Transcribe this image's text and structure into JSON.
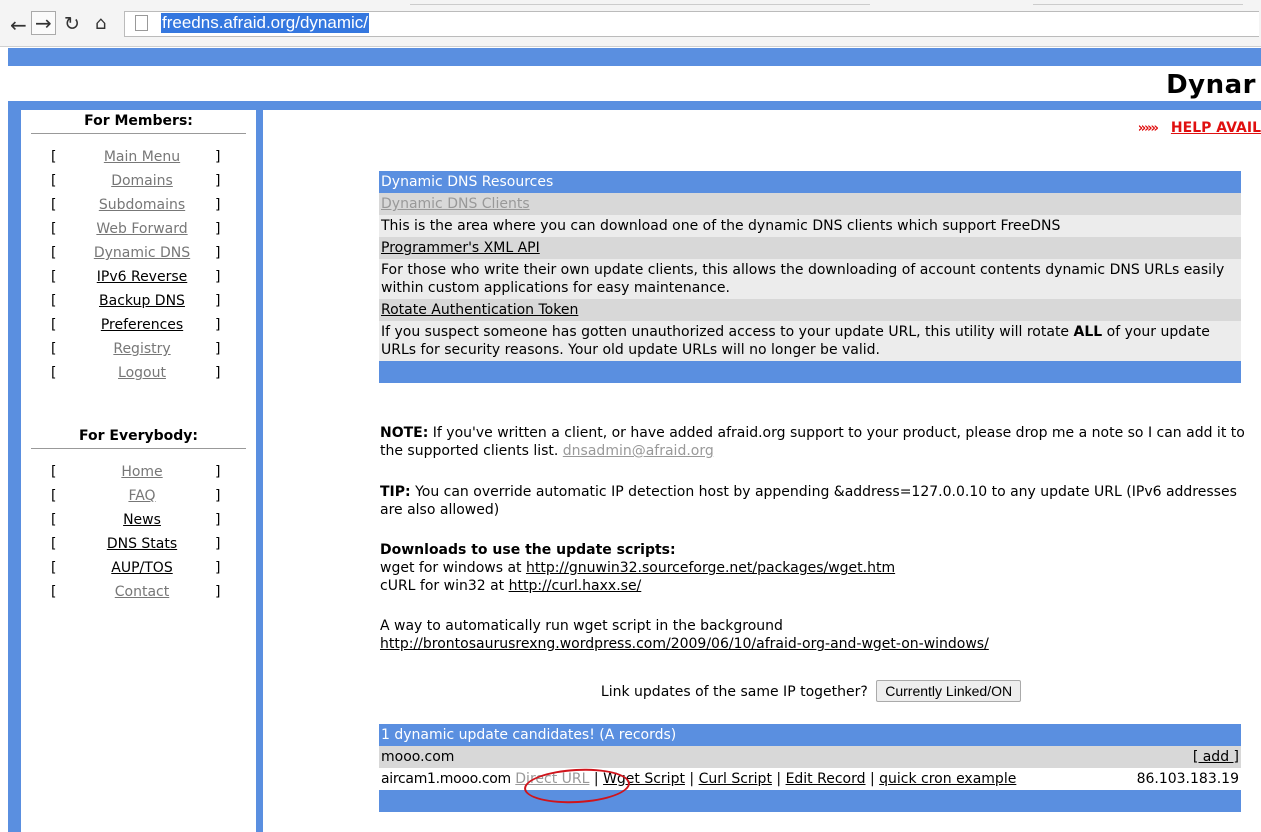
{
  "browser": {
    "url": "freedns.afraid.org/dynamic/"
  },
  "banner": {
    "title": "Dynar"
  },
  "sidebar": {
    "members_title": "For Members:",
    "members": [
      "Main Menu",
      "Domains",
      "Subdomains",
      "Web Forward",
      "Dynamic DNS",
      "IPv6 Reverse",
      "Backup DNS",
      "Preferences",
      "Registry",
      "Logout"
    ],
    "everybody_title": "For Everybody:",
    "everybody": [
      "Home",
      "FAQ",
      "News",
      "DNS Stats",
      "AUP/TOS",
      "Contact"
    ],
    "bracket_open": "[",
    "bracket_close": "]"
  },
  "help": {
    "arrow": "»»»",
    "label": "HELP AVAIL"
  },
  "resources": {
    "title": "Dynamic DNS Resources",
    "clients_label": "Dynamic DNS Clients",
    "clients_desc": "This is the area where you can download one of the dynamic DNS clients which support FreeDNS",
    "xml_label": "Programmer's XML API",
    "xml_desc": "For those who write their own update clients, this allows the downloading of account contents dynamic DNS URLs easily within custom applications for easy maintenance.",
    "rotate_label": "Rotate Authentication Token",
    "rotate_desc_1": "If you suspect someone has gotten unauthorized access to your update URL, this utility will rotate ",
    "rotate_desc_bold": "ALL",
    "rotate_desc_2": " of your update URLs for security reasons. Your old update URLs will no longer be valid."
  },
  "note": {
    "label": "NOTE:",
    "text": " If you've written a client, or have added afraid.org support to your product, please drop me a note so I can add it to the supported clients list. ",
    "email": "dnsadmin@afraid.org"
  },
  "tip": {
    "label": "TIP:",
    "text": " You can override automatic IP detection host by appending &address=127.0.0.10 to any update URL (IPv6 addresses are also allowed)"
  },
  "downloads": {
    "title": "Downloads to use the update scripts:",
    "wget_prefix": "wget for windows at ",
    "wget_url": "http://gnuwin32.sourceforge.net/packages/wget.htm",
    "curl_prefix": "cURL for win32 at ",
    "curl_url": "http://curl.haxx.se/"
  },
  "background": {
    "text": "A way to automatically run wget script in the background",
    "url": "http://brontosaurusrexng.wordpress.com/2009/06/10/afraid-org-and-wget-on-windows/"
  },
  "link_updates": {
    "question": "Link updates of the same IP together?",
    "button": "Currently Linked/ON"
  },
  "candidates": {
    "title": "1 dynamic update candidates! (A records)",
    "domain": "mooo.com",
    "add": "[ add ]",
    "host": "aircam1.mooo.com",
    "direct_url": "Direct URL",
    "wget_script": "Wget Script",
    "curl_script": "Curl Script",
    "edit_record": "Edit Record",
    "cron": "quick cron example",
    "separator": "|",
    "ip": "86.103.183.19"
  }
}
